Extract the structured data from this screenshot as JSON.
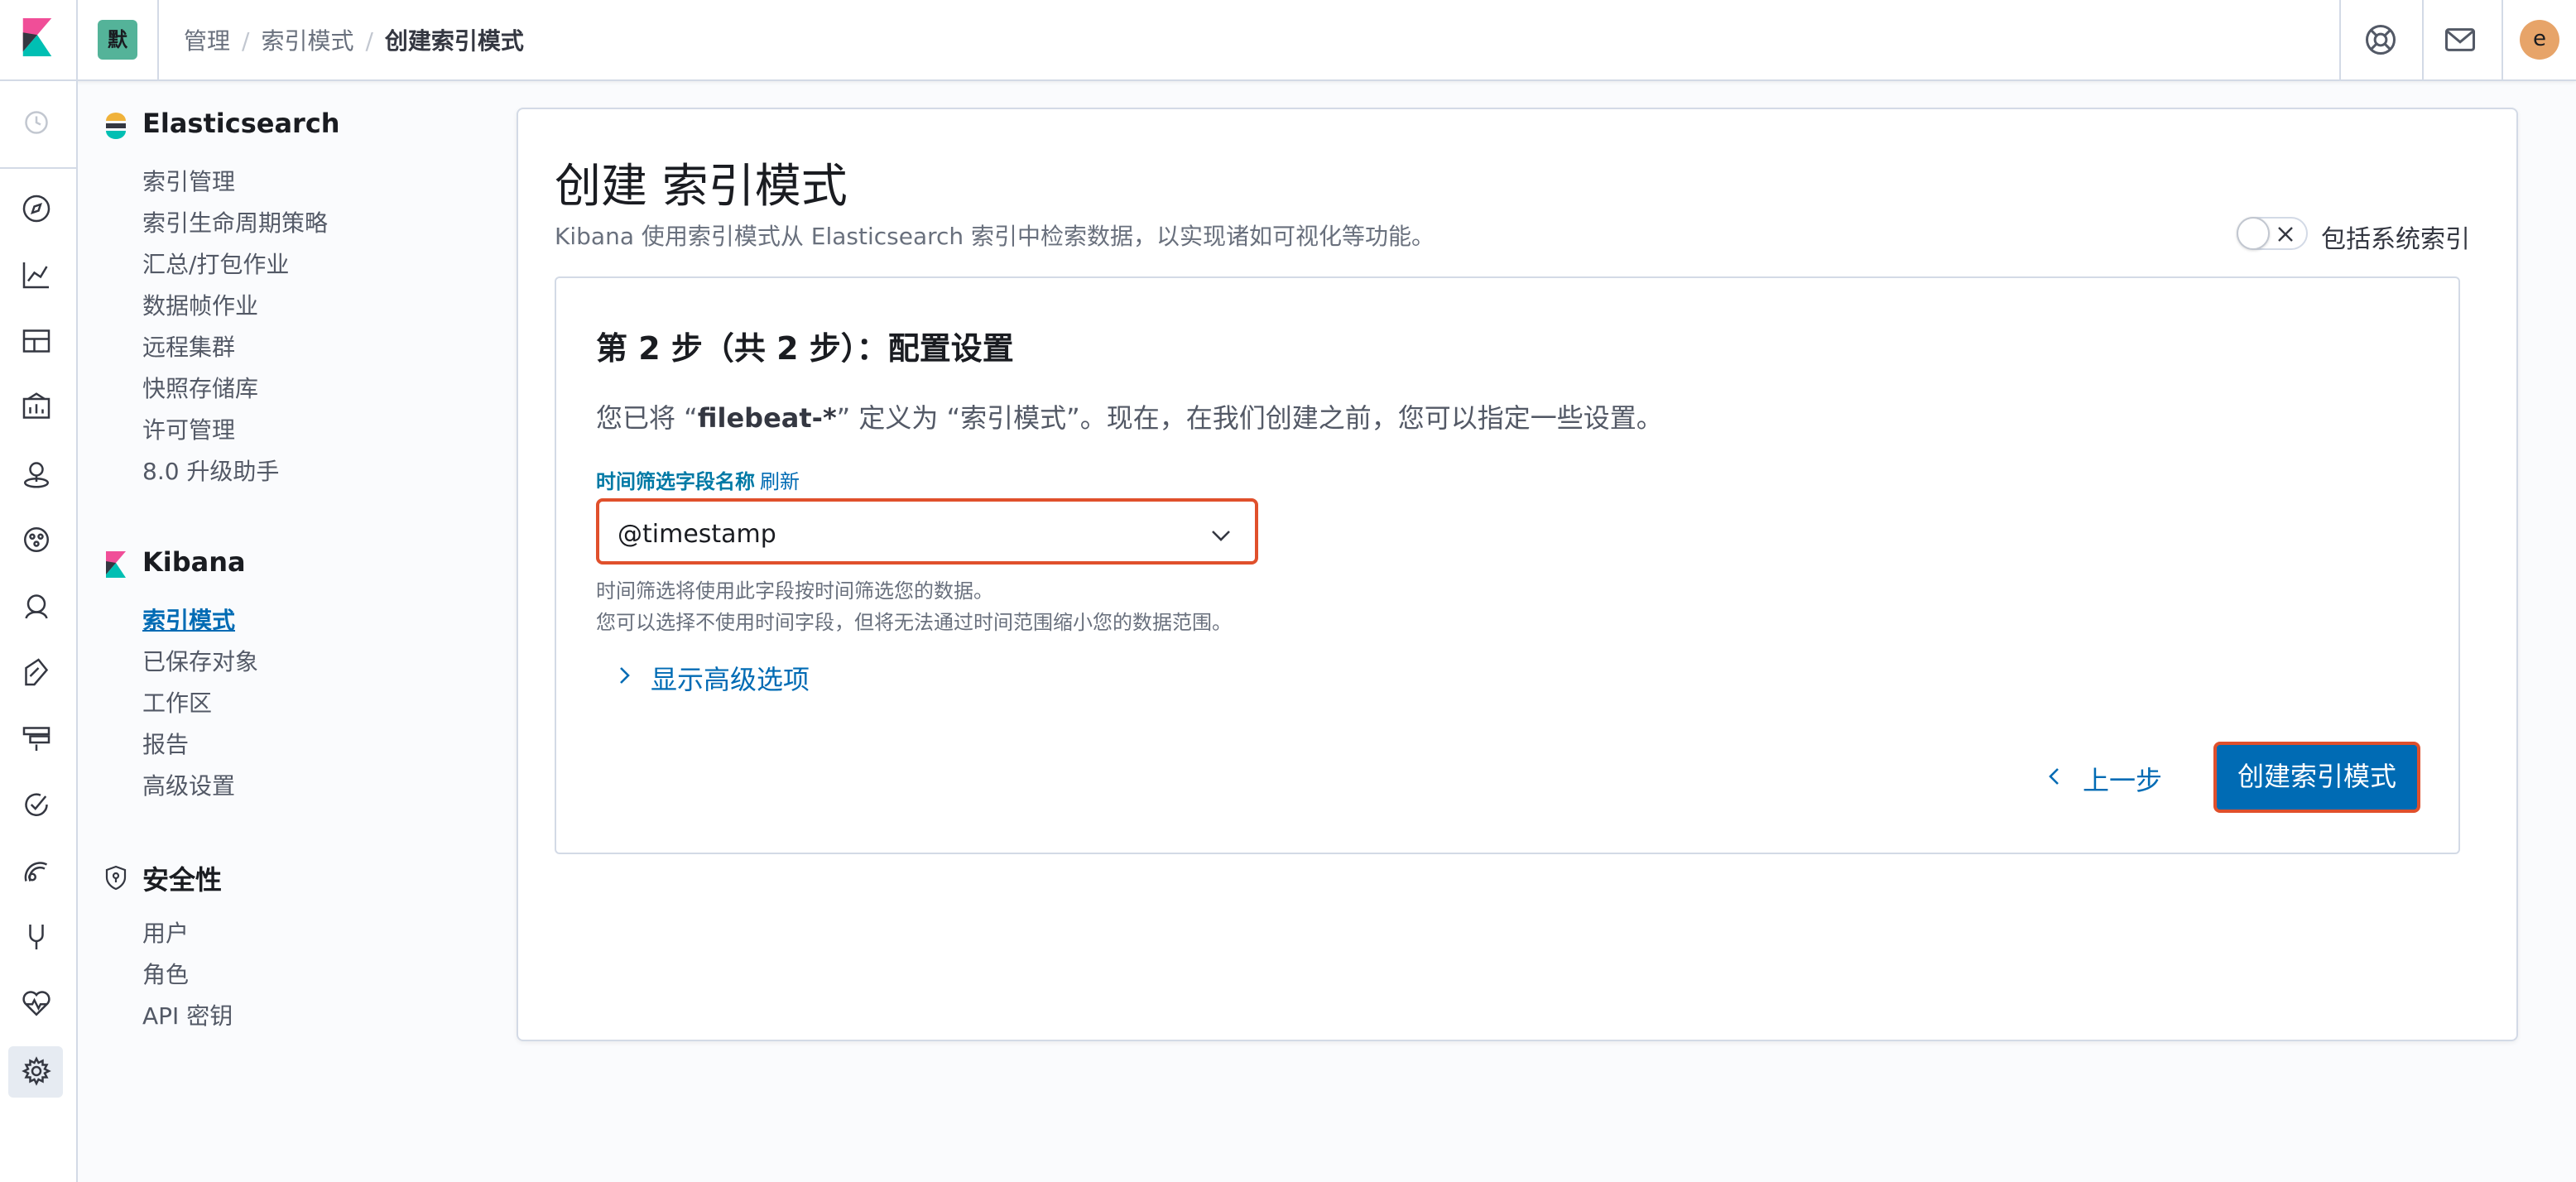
{
  "header": {
    "space_badge": "默",
    "breadcrumbs": [
      "管理",
      "索引模式",
      "创建索引模式"
    ],
    "avatar_initial": "e",
    "icons": [
      "kibana-logo-icon",
      "help-icon",
      "mail-icon"
    ]
  },
  "rail": {
    "icons": [
      "clock-icon",
      "compass-icon",
      "chart-icon",
      "dashboard-icon",
      "canvas-icon",
      "maps-icon",
      "ml-icon",
      "metrics-icon",
      "logs-icon",
      "apm-icon",
      "uptime-icon",
      "siem-icon",
      "devtools-icon",
      "monitoring-icon",
      "gear-icon"
    ]
  },
  "sidenav": {
    "elasticsearch": {
      "title": "Elasticsearch",
      "items": [
        "索引管理",
        "索引生命周期策略",
        "汇总/打包作业",
        "数据帧作业",
        "远程集群",
        "快照存储库",
        "许可管理",
        "8.0 升级助手"
      ]
    },
    "kibana": {
      "title": "Kibana",
      "items": [
        "索引模式",
        "已保存对象",
        "工作区",
        "报告",
        "高级设置"
      ],
      "selected": "索引模式"
    },
    "security": {
      "title": "安全性",
      "items": [
        "用户",
        "角色",
        "API 密钥"
      ]
    }
  },
  "main": {
    "title": "创建 索引模式",
    "description": "Kibana 使用索引模式从 Elasticsearch 索引中检索数据，以实现诸如可视化等功能。",
    "toggle_label": "包括系统索引",
    "toggle_on": false,
    "step_title": "第 2 步（共 2 步）：配置设置",
    "step_desc_prefix": "您已将 “",
    "step_desc_pattern": "filebeat-*",
    "step_desc_suffix": "” 定义为 “索引模式”。现在，在我们创建之前，您可以指定一些设置。",
    "field_label": "时间筛选字段名称",
    "refresh_label": "刷新",
    "select_value": "@timestamp",
    "help_line1": "时间筛选将使用此字段按时间筛选您的数据。",
    "help_line2": "您可以选择不使用时间字段，但将无法通过时间范围缩小您的数据范围。",
    "advanced_label": "显示高级选项",
    "back_label": "上一步",
    "create_label": "创建索引模式"
  },
  "colors": {
    "primary": "#006bb4",
    "highlight_border": "#e0502c",
    "space_badge": "#54b399",
    "avatar": "#e7a469"
  }
}
